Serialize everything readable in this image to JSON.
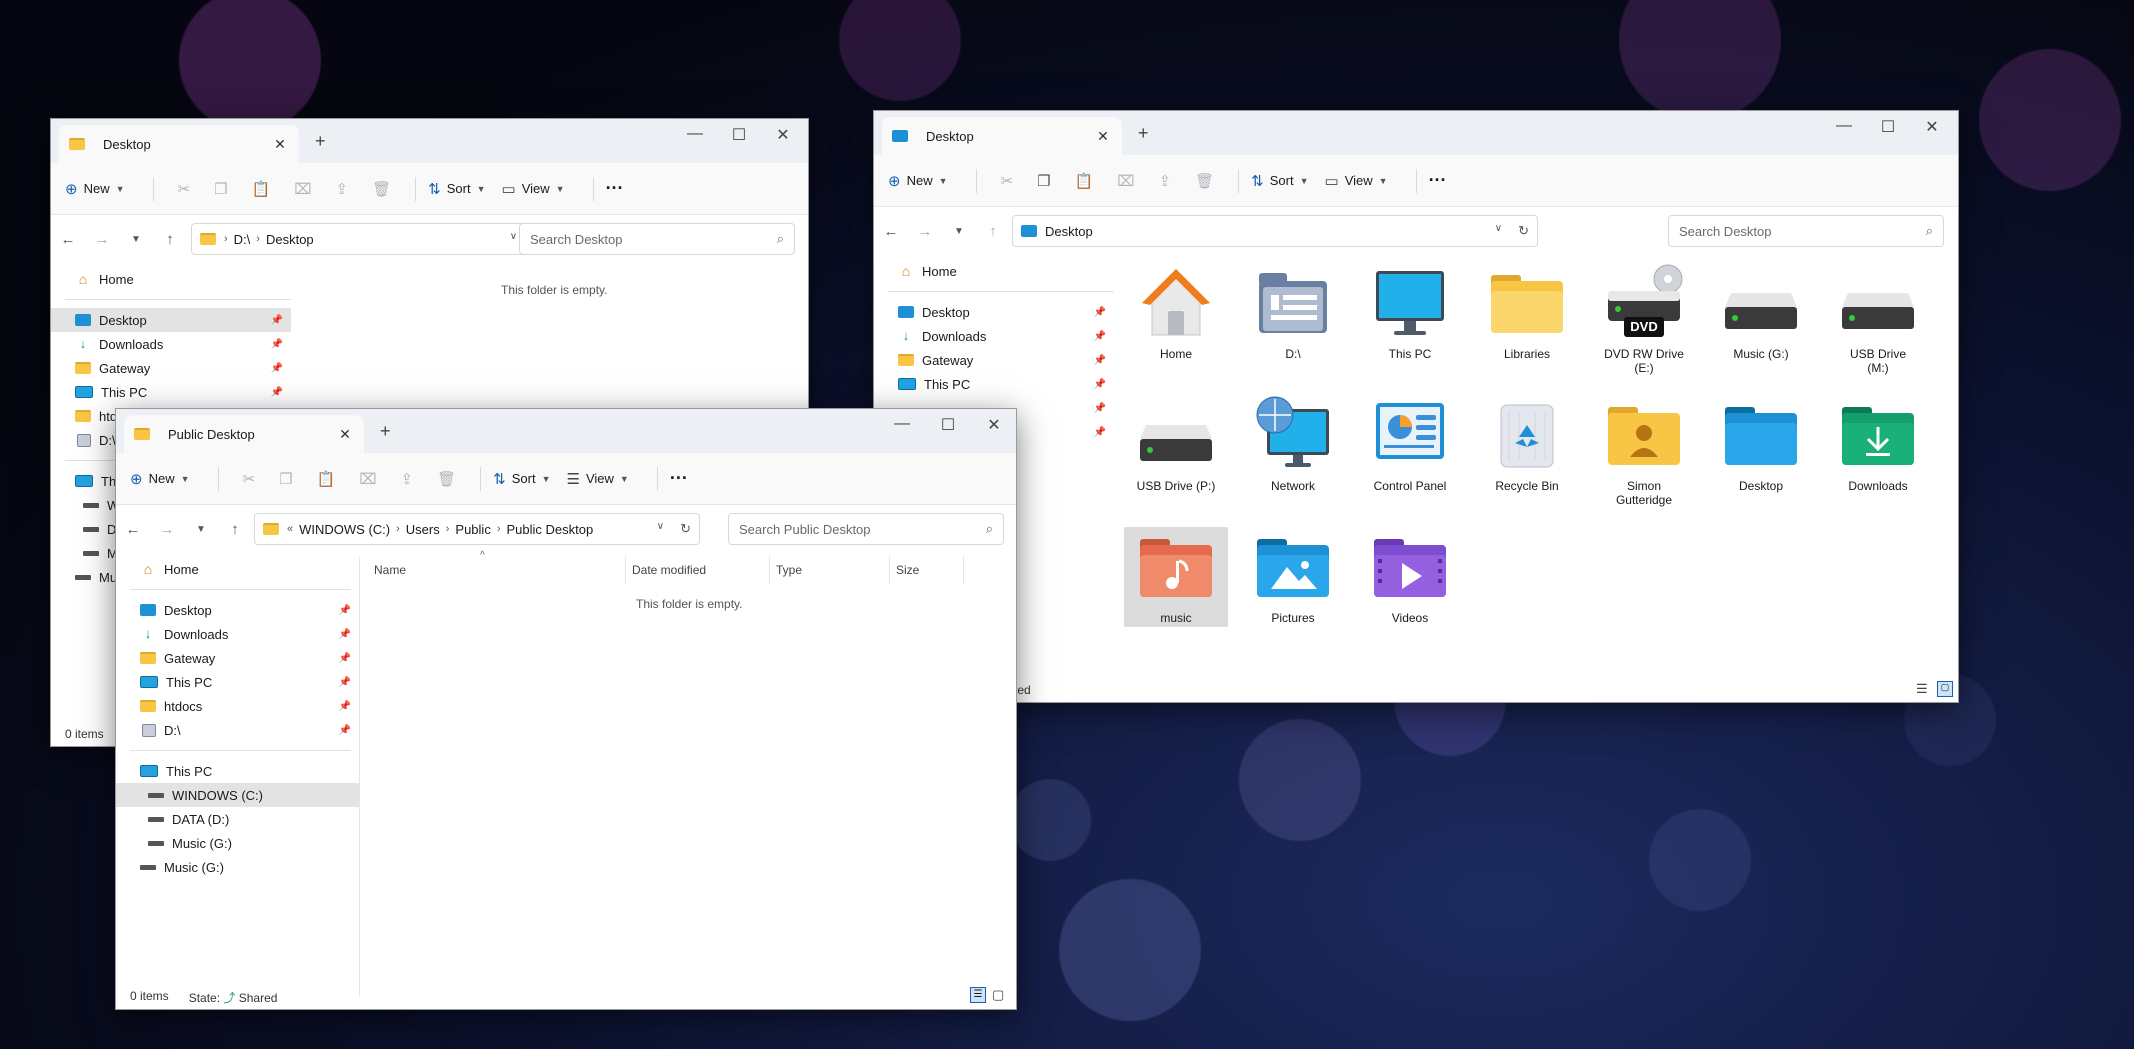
{
  "window1": {
    "tab_title": "Desktop",
    "toolbar": {
      "new_label": "New",
      "sort_label": "Sort",
      "view_label": "View"
    },
    "breadcrumb": [
      "D:\\",
      "Desktop"
    ],
    "search_placeholder": "Search Desktop",
    "nav": {
      "home": "Home",
      "quick": [
        {
          "label": "Desktop",
          "icon": "desktop-icon"
        },
        {
          "label": "Downloads",
          "icon": "download-icon"
        },
        {
          "label": "Gateway",
          "icon": "folder-icon"
        },
        {
          "label": "This PC",
          "icon": "pc-icon"
        },
        {
          "label": "htd",
          "icon": "folder-icon"
        },
        {
          "label": "D:\\",
          "icon": "drive-icon"
        }
      ],
      "tree": [
        "This",
        "W",
        "DA",
        "M",
        "Mu"
      ]
    },
    "empty_text": "This folder is empty.",
    "status": "0 items"
  },
  "window2": {
    "tab_title": "Desktop",
    "toolbar": {
      "new_label": "New",
      "sort_label": "Sort",
      "view_label": "View"
    },
    "breadcrumb": [
      "Desktop"
    ],
    "search_placeholder": "Search Desktop",
    "nav": {
      "home": "Home",
      "quick": [
        {
          "label": "Desktop",
          "icon": "desktop-icon"
        },
        {
          "label": "Downloads",
          "icon": "download-icon"
        },
        {
          "label": "Gateway",
          "icon": "folder-icon"
        },
        {
          "label": "This PC",
          "icon": "pc-icon"
        }
      ]
    },
    "items": [
      {
        "label": "Home",
        "icon": "home-icon"
      },
      {
        "label": "D:\\",
        "icon": "document-folder-icon"
      },
      {
        "label": "This PC",
        "icon": "monitor-icon"
      },
      {
        "label": "Libraries",
        "icon": "folder-icon"
      },
      {
        "label": "DVD RW Drive (E:)",
        "icon": "dvd-drive-icon",
        "badge": "DVD"
      },
      {
        "label": "Music (G:)",
        "icon": "drive-icon"
      },
      {
        "label": "USB Drive (M:)",
        "icon": "drive-icon"
      },
      {
        "label": "USB Drive (P:)",
        "icon": "drive-icon"
      },
      {
        "label": "Network",
        "icon": "network-icon"
      },
      {
        "label": "Control Panel",
        "icon": "control-panel-icon"
      },
      {
        "label": "Recycle Bin",
        "icon": "recycle-bin-icon"
      },
      {
        "label": "Simon Gutteridge",
        "icon": "user-folder-icon"
      },
      {
        "label": "Desktop",
        "icon": "desktop-folder-icon"
      },
      {
        "label": "Downloads",
        "icon": "downloads-folder-icon"
      },
      {
        "label": "music",
        "icon": "music-folder-icon",
        "selected": true
      },
      {
        "label": "Pictures",
        "icon": "pictures-folder-icon"
      },
      {
        "label": "Videos",
        "icon": "videos-folder-icon"
      }
    ],
    "status_partial": "ted"
  },
  "window3": {
    "tab_title": "Public Desktop",
    "toolbar": {
      "new_label": "New",
      "sort_label": "Sort",
      "view_label": "View"
    },
    "breadcrumb": [
      "WINDOWS (C:)",
      "Users",
      "Public",
      "Public Desktop"
    ],
    "search_placeholder": "Search Public Desktop",
    "nav": {
      "home": "Home",
      "quick": [
        {
          "label": "Desktop",
          "icon": "desktop-icon"
        },
        {
          "label": "Downloads",
          "icon": "download-icon"
        },
        {
          "label": "Gateway",
          "icon": "folder-icon"
        },
        {
          "label": "This PC",
          "icon": "pc-icon"
        },
        {
          "label": "htdocs",
          "icon": "folder-icon"
        },
        {
          "label": "D:\\",
          "icon": "drive-icon"
        }
      ],
      "this_pc": "This PC",
      "drives": [
        {
          "label": "WINDOWS (C:)",
          "selected": true
        },
        {
          "label": "DATA (D:)"
        },
        {
          "label": "Music (G:)"
        }
      ],
      "music_root": "Music (G:)"
    },
    "columns": [
      "Name",
      "Date modified",
      "Type",
      "Size"
    ],
    "empty_text": "This folder is empty.",
    "status": {
      "items": "0 items",
      "state_label": "State:",
      "state_value": "Shared"
    }
  }
}
